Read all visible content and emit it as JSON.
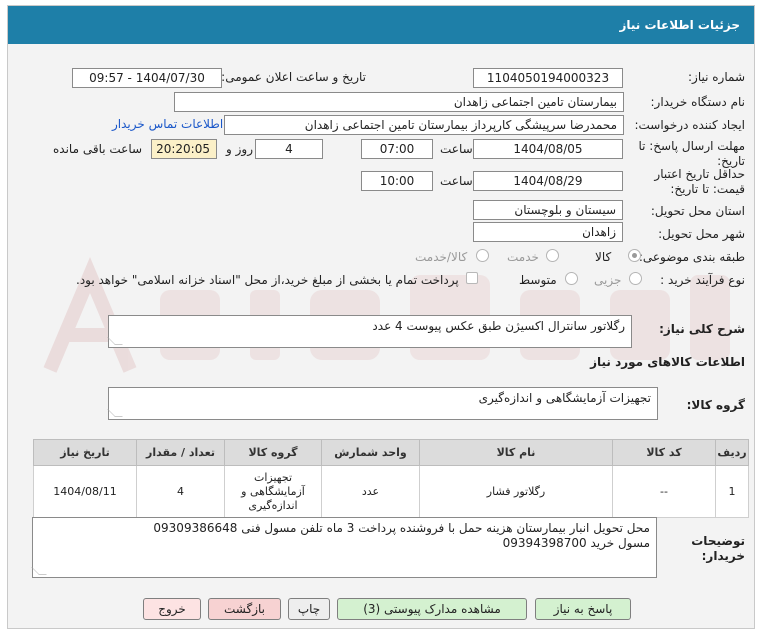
{
  "window": {
    "title": "جزئیات اطلاعات نیاز"
  },
  "fields": {
    "need_number_label": "شماره نیاز:",
    "need_number": "1104050194000323",
    "announce_label": "تاریخ و ساعت اعلان عمومی:",
    "announce_value": "1404/07/30 - 09:57",
    "buyer_org_label": "نام دستگاه خریدار:",
    "buyer_org": "بیمارستان تامین اجتماعی زاهدان",
    "creator_label": "ایجاد کننده درخواست:",
    "creator": "محمدرضا سرپیشگی کارپرداز بیمارستان تامین اجتماعی زاهدان",
    "contact_link": "اطلاعات تماس خریدار",
    "deadline_label_1": "مهلت ارسال پاسخ: تا",
    "deadline_label_2": "تاریخ:",
    "deadline_date": "1404/08/05",
    "time_label": "ساعت",
    "deadline_time": "07:00",
    "days_value": "4",
    "days_label": "روز و",
    "remaining_time": "20:20:05",
    "remaining_label": "ساعت باقی مانده",
    "validity_label_1": "حداقل تاریخ اعتبار",
    "validity_label_2": "قیمت: تا تاریخ:",
    "validity_date": "1404/08/29",
    "validity_time": "10:00",
    "province_label": "استان محل تحویل:",
    "province": "سیستان و بلوچستان",
    "city_label": "شهر محل تحویل:",
    "city": "زاهدان",
    "category_label": "طبقه بندی موضوعی:",
    "category_options": [
      "کالا",
      "خدمت",
      "کالا/خدمت"
    ],
    "purchase_type_label": "نوع فرآیند خرید :",
    "purchase_options": [
      "جزیی",
      "متوسط"
    ],
    "payment_note": "پرداخت تمام یا بخشی از مبلغ خرید،از محل \"اسناد خزانه اسلامی\" خواهد بود."
  },
  "summary": {
    "label": "شرح کلی نیاز:",
    "text": "رگلاتور سانترال اکسیژن طبق عکس پیوست  4 عدد"
  },
  "goods_section": {
    "title": "اطلاعات کالاهای مورد نیاز",
    "group_label": "گروه کالا:",
    "group_value": "تجهیزات آزمایشگاهی و اندازه‌گیری"
  },
  "table": {
    "headers": [
      "ردیف",
      "کد کالا",
      "نام کالا",
      "واحد شمارش",
      "گروه کالا",
      "تعداد / مقدار",
      "تاریخ نیاز"
    ],
    "rows": [
      {
        "row": "1",
        "code": "--",
        "name": "رگلاتور فشار",
        "unit": "عدد",
        "group": "تجهیزات آزمایشگاهی و اندازه‌گیری",
        "qty": "4",
        "date": "1404/08/11"
      }
    ]
  },
  "description": {
    "label_1": "توضیحات",
    "label_2": "خریدار:",
    "line1": "محل تحویل انبار بیمارستان هزینه حمل با فروشنده پرداخت 3 ماه تلفن مسول فنی 09309386648",
    "line2": "مسول خرید 09394398700"
  },
  "buttons": {
    "reply": "پاسخ به نیاز",
    "view_docs": "مشاهده مدارک پیوستی (3)",
    "print": "چاپ",
    "back": "بازگشت",
    "exit": "خروج"
  },
  "colors": {
    "titlebar": "#1e7fa8",
    "link": "#1a57c9",
    "remaining_bg": "#fbf0c8"
  }
}
